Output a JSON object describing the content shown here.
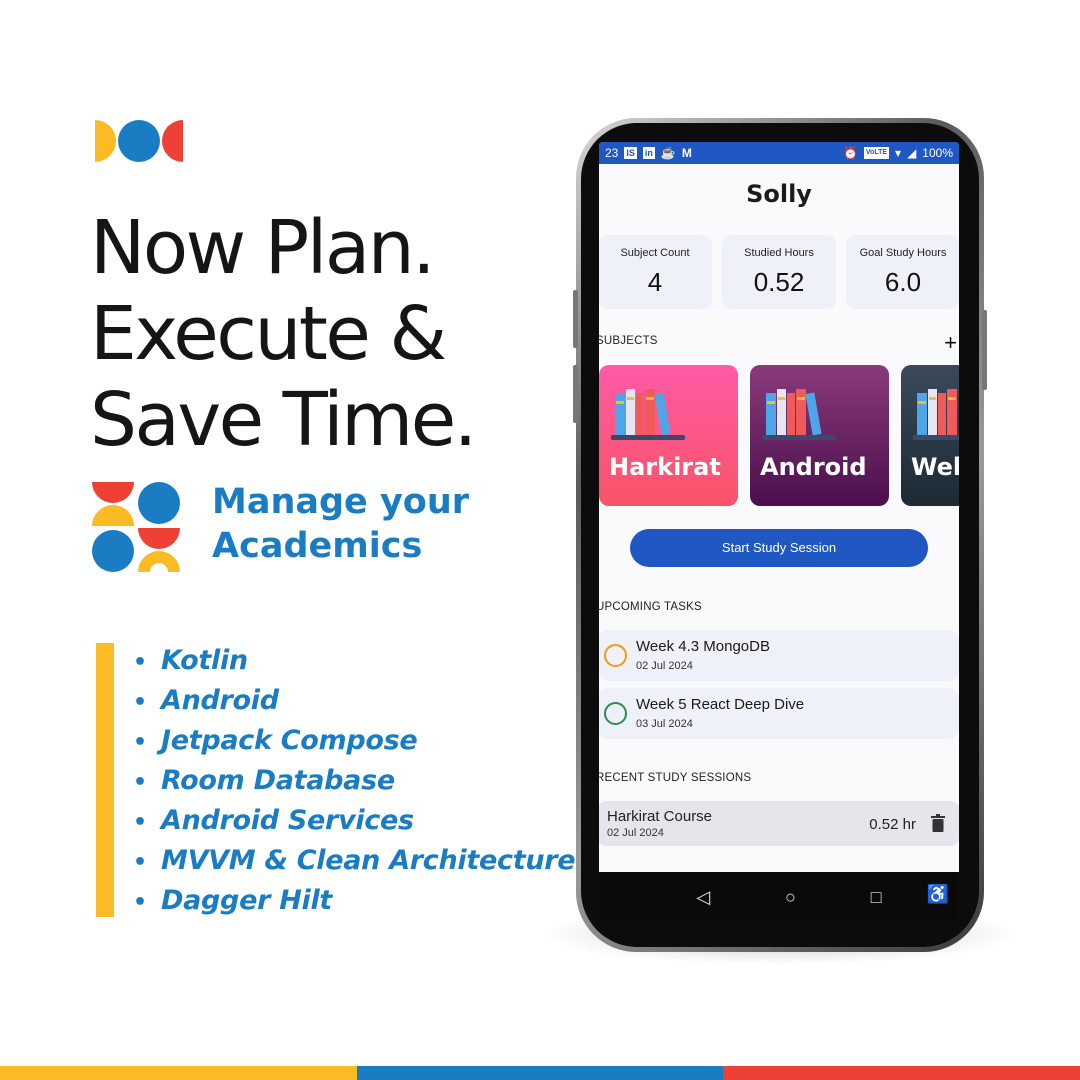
{
  "headline": [
    "Now Plan.",
    "Execute &",
    "Save Time."
  ],
  "subtitle": [
    "Manage your",
    "Academics"
  ],
  "tech_list": [
    "Kotlin",
    "Android",
    "Jetpack Compose",
    "Room Database",
    "Android Services",
    "MVVM & Clean Architecture",
    "Dagger Hilt"
  ],
  "colors": {
    "yellow": "#fbbb24",
    "blue": "#1a7dc4",
    "red": "#ef4035",
    "app_blue": "#1f57c3"
  },
  "app": {
    "status_bar": {
      "time": "23",
      "icons_left": [
        "IS",
        "in"
      ],
      "battery": "100%",
      "volte": "VoLTE"
    },
    "title": "Solly",
    "stats": [
      {
        "label": "Subject Count",
        "value": "4"
      },
      {
        "label": "Studied Hours",
        "value": "0.52"
      },
      {
        "label": "Goal Study Hours",
        "value": "6.0"
      }
    ],
    "subjects_label": "SUBJECTS",
    "add_icon": "+",
    "subjects": [
      {
        "name": "Harkirat",
        "icon": "books-icon"
      },
      {
        "name": "Android",
        "icon": "books-icon"
      },
      {
        "name": "Web",
        "icon": "books-icon"
      }
    ],
    "start_button": "Start Study Session",
    "upcoming_label": "UPCOMING TASKS",
    "tasks": [
      {
        "title": "Week 4.3 MongoDB",
        "date": "02 Jul 2024",
        "priority_color": "#f19a1d"
      },
      {
        "title": "Week 5 React Deep Dive",
        "date": "03 Jul 2024",
        "priority_color": "#2e8b57"
      }
    ],
    "recent_label": "RECENT STUDY SESSIONS",
    "sessions": [
      {
        "title": "Harkirat Course",
        "date": "02 Jul 2024",
        "hours": "0.52 hr"
      }
    ],
    "nav": {
      "back": "◁",
      "home": "○",
      "recents": "□",
      "accessibility": "accessibility-icon"
    }
  }
}
